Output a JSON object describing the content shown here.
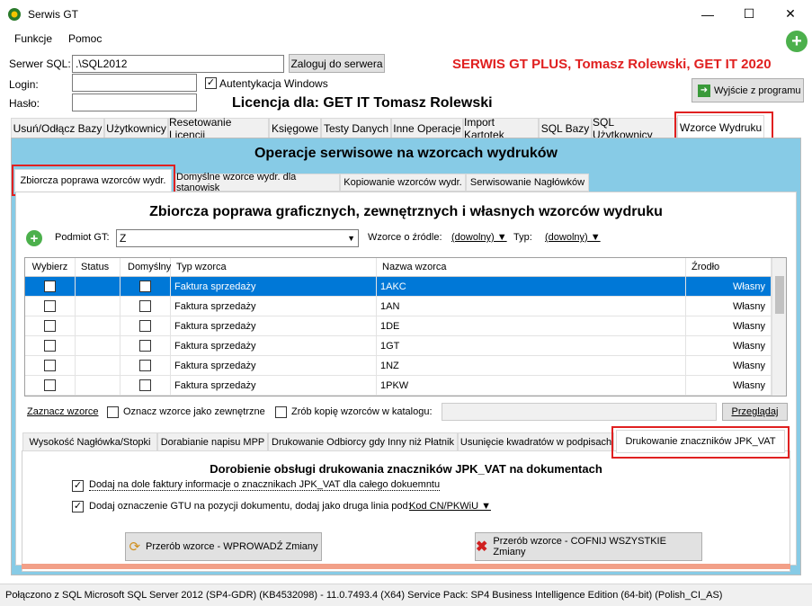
{
  "window": {
    "title": "Serwis GT",
    "minimize_icon": "minimize-icon",
    "maximize_icon": "maximize-icon",
    "close_icon": "close-icon"
  },
  "menu": {
    "items": [
      "Funkcje",
      "Pomoc"
    ]
  },
  "connection": {
    "server_label": "Serwer SQL:",
    "server_value": ".\\SQL2012",
    "login_button": "Zaloguj do serwera",
    "login_label": "Login:",
    "login_value": "",
    "password_label": "Hasło:",
    "password_value": "",
    "auth_windows_label": "Autentykacja Windows",
    "auth_windows_checked": true
  },
  "brand": {
    "banner": "SERWIS GT PLUS, Tomasz Rolewski, GET IT 2020",
    "banner_color": "#e02020",
    "license": "Licencja dla: GET IT Tomasz Rolewski"
  },
  "exit_button": "Wyjście z programu",
  "main_tabs": [
    "Usuń/Odłącz Bazy",
    "Użytkownicy",
    "Resetowanie Licencji",
    "Księgowe",
    "Testy Danych",
    "Inne Operacje",
    "Import Kartotek",
    "SQL Bazy",
    "SQL Użytkownicy",
    "Wzorce Wydruku"
  ],
  "main_tabs_active": "Wzorce Wydruku",
  "section_title": "Operacje serwisowe na wzorcach wydruków",
  "sub_tabs": [
    "Zbiorcza poprawa wzorców wydr.",
    "Domyślne wzorce wydr. dla stanowisk",
    "Kopiowanie wzorców wydr.",
    "Serwisowanie Nagłówków"
  ],
  "sub_tabs_active": "Zbiorcza poprawa wzorców wydr.",
  "panel_title": "Zbiorcza poprawa graficznych, zewnętrznych i własnych wzorców wydruku",
  "filters": {
    "entity_label": "Podmiot GT:",
    "entity_value": "Z",
    "source_label": "Wzorce o źródle:",
    "source_value": "(dowolny) ▼",
    "type_label": "Typ:",
    "type_value": "(dowolny) ▼"
  },
  "grid": {
    "columns": [
      "Wybierz",
      "Status",
      "Domyślny",
      "Typ wzorca",
      "Nazwa wzorca",
      "Źrodło"
    ],
    "rows": [
      {
        "type": "Faktura sprzedaży",
        "name": "1AKC",
        "source": "Własny",
        "selected": true
      },
      {
        "type": "Faktura sprzedaży",
        "name": "1AN",
        "source": "Własny",
        "selected": false
      },
      {
        "type": "Faktura sprzedaży",
        "name": "1DE",
        "source": "Własny",
        "selected": false
      },
      {
        "type": "Faktura sprzedaży",
        "name": "1GT",
        "source": "Własny",
        "selected": false
      },
      {
        "type": "Faktura sprzedaży",
        "name": "1NZ",
        "source": "Własny",
        "selected": false
      },
      {
        "type": "Faktura sprzedaży",
        "name": "1PKW",
        "source": "Własny",
        "selected": false
      }
    ]
  },
  "grid_actions": {
    "mark_link": "Zaznacz wzorce",
    "mark_external_label": "Oznacz wzorce jako zewnętrzne",
    "copy_label": "Zrób kopię wzorców w katalogu:",
    "browse_button": "Przeglądaj"
  },
  "bottom_tabs": [
    "Wysokość Nagłówka/Stopki",
    "Dorabianie napisu MPP",
    "Drukowanie Odbiorcy gdy Inny niż Płatnik",
    "Usunięcie kwadratów w podpisach",
    "Drukowanie znaczników JPK_VAT"
  ],
  "bottom_tabs_active": "Drukowanie znaczników JPK_VAT",
  "jpk": {
    "title": "Dorobienie obsługi drukowania znaczników JPK_VAT na dokumentach",
    "option1": "Dodaj na dole faktury informacje o znacznikach JPK_VAT dla całego dokuemntu",
    "option2": "Dodaj oznaczenie GTU na pozycji dokumentu, dodaj jako druga linia pod:",
    "option2_value": "Kod CN/PKWiU ▼",
    "apply_button": "Przerób wzorce - WPROWADŹ Zmiany",
    "revert_button": "Przerób wzorce - COFNIJ WSZYSTKIE Zmiany"
  },
  "status_bar": "Połączono z SQL  Microsoft SQL Server 2012 (SP4-GDR) (KB4532098) - 11.0.7493.4 (X64)  Service Pack: SP4 Business Intelligence Edition (64-bit) (Polish_CI_AS)",
  "colors": {
    "accent_blue": "#87cbe6",
    "selection": "#0078d7",
    "highlight_red": "#e02020"
  }
}
